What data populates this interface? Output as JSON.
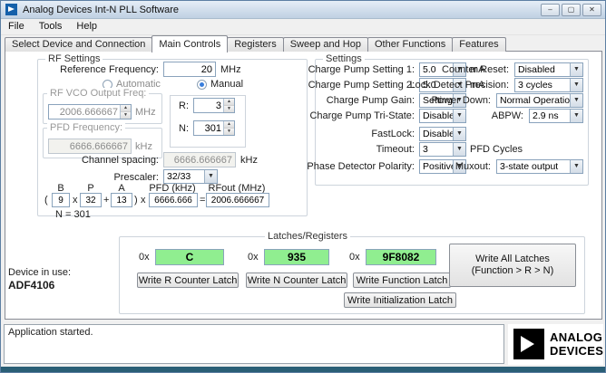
{
  "colors": {
    "latch_field_green": "#90ee90",
    "bottom_bar": "#2a5f76",
    "app_icon_blue": "#1460aa"
  },
  "window": {
    "title": "Analog Devices Int-N PLL Software",
    "controls": {
      "minimize": "–",
      "maximize": "▢",
      "close": "✕"
    },
    "menu": {
      "file": "File",
      "tools": "Tools",
      "help": "Help"
    },
    "tabs": {
      "select_device": "Select Device and Connection",
      "main_controls": "Main Controls",
      "registers": "Registers",
      "sweep_and_hop": "Sweep and Hop",
      "other_functions": "Other Functions",
      "features": "Features"
    }
  },
  "rf": {
    "group_label": "RF Settings",
    "reference_frequency": {
      "label": "Reference Frequency:",
      "value": "20",
      "unit": "MHz"
    },
    "mode": {
      "automatic": "Automatic",
      "manual": "Manual",
      "selected": "Manual"
    },
    "vco": {
      "label": "RF VCO Output Freq:",
      "value": "2006.666667",
      "unit": "MHz"
    },
    "pfd": {
      "label": "PFD Frequency:",
      "value": "6666.666667",
      "unit": "kHz"
    },
    "r_counter": {
      "label": "R:",
      "value": "3"
    },
    "n_counter": {
      "label": "N:",
      "value": "301"
    },
    "channel_spacing": {
      "label": "Channel spacing:",
      "value": "6666.666667",
      "unit": "kHz"
    },
    "prescaler": {
      "label": "Prescaler:",
      "value": "32/33"
    },
    "formula": {
      "b_header": "B",
      "p_header": "P",
      "a_header": "A",
      "pfd_header": "PFD (kHz)",
      "rfout_header": "RFout (MHz)",
      "open_paren": "(",
      "times": "x",
      "plus": "+",
      "close_paren": ")",
      "equals": "=",
      "b": "9",
      "p": "32",
      "a": "13",
      "pfd": "6666.666",
      "rfout": "2006.666667",
      "n_equation": "N = 301"
    }
  },
  "settings": {
    "group_label": "Settings",
    "charge_pump_setting_1": {
      "label": "Charge Pump Setting 1:",
      "value": "5.0",
      "suffix": "mA"
    },
    "charge_pump_setting_2": {
      "label": "Charge Pump Setting 2:",
      "value": "5.0",
      "suffix": "mA"
    },
    "charge_pump_gain": {
      "label": "Charge Pump Gain:",
      "value": "Setting 1"
    },
    "charge_pump_tri_state": {
      "label": "Charge Pump Tri-State:",
      "value": "Disabled"
    },
    "fastlock": {
      "label": "FastLock:",
      "value": "Disabled"
    },
    "timeout": {
      "label": "Timeout:",
      "value": "3",
      "suffix": "PFD Cycles"
    },
    "phase_detector_polarity": {
      "label": "Phase Detector Polarity:",
      "value": "Positive"
    },
    "counter_reset": {
      "label": "Counter Reset:",
      "value": "Disabled"
    },
    "lock_detect_precision": {
      "label": "Lock Detect Precision:",
      "value": "3 cycles"
    },
    "power_down": {
      "label": "Power Down:",
      "value": "Normal Operation"
    },
    "abpw": {
      "label": "ABPW:",
      "value": "2.9 ns"
    },
    "muxout": {
      "label": "Muxout:",
      "value": "3-state output"
    }
  },
  "latches": {
    "group_label": "Latches/Registers",
    "hex_prefix": "0x",
    "r_latch": "C",
    "n_latch": "935",
    "function_latch": "9F8082",
    "write_r": "Write R Counter Latch",
    "write_n": "Write N Counter Latch",
    "write_function": "Write Function Latch",
    "write_init": "Write Initialization Latch",
    "write_all_line1": "Write All Latches",
    "write_all_line2": "(Function > R > N)"
  },
  "device": {
    "label": "Device in use:",
    "name": "ADF4106"
  },
  "status": {
    "text": "Application started."
  },
  "logo": {
    "line1": "ANALOG",
    "line2": "DEVICES"
  }
}
